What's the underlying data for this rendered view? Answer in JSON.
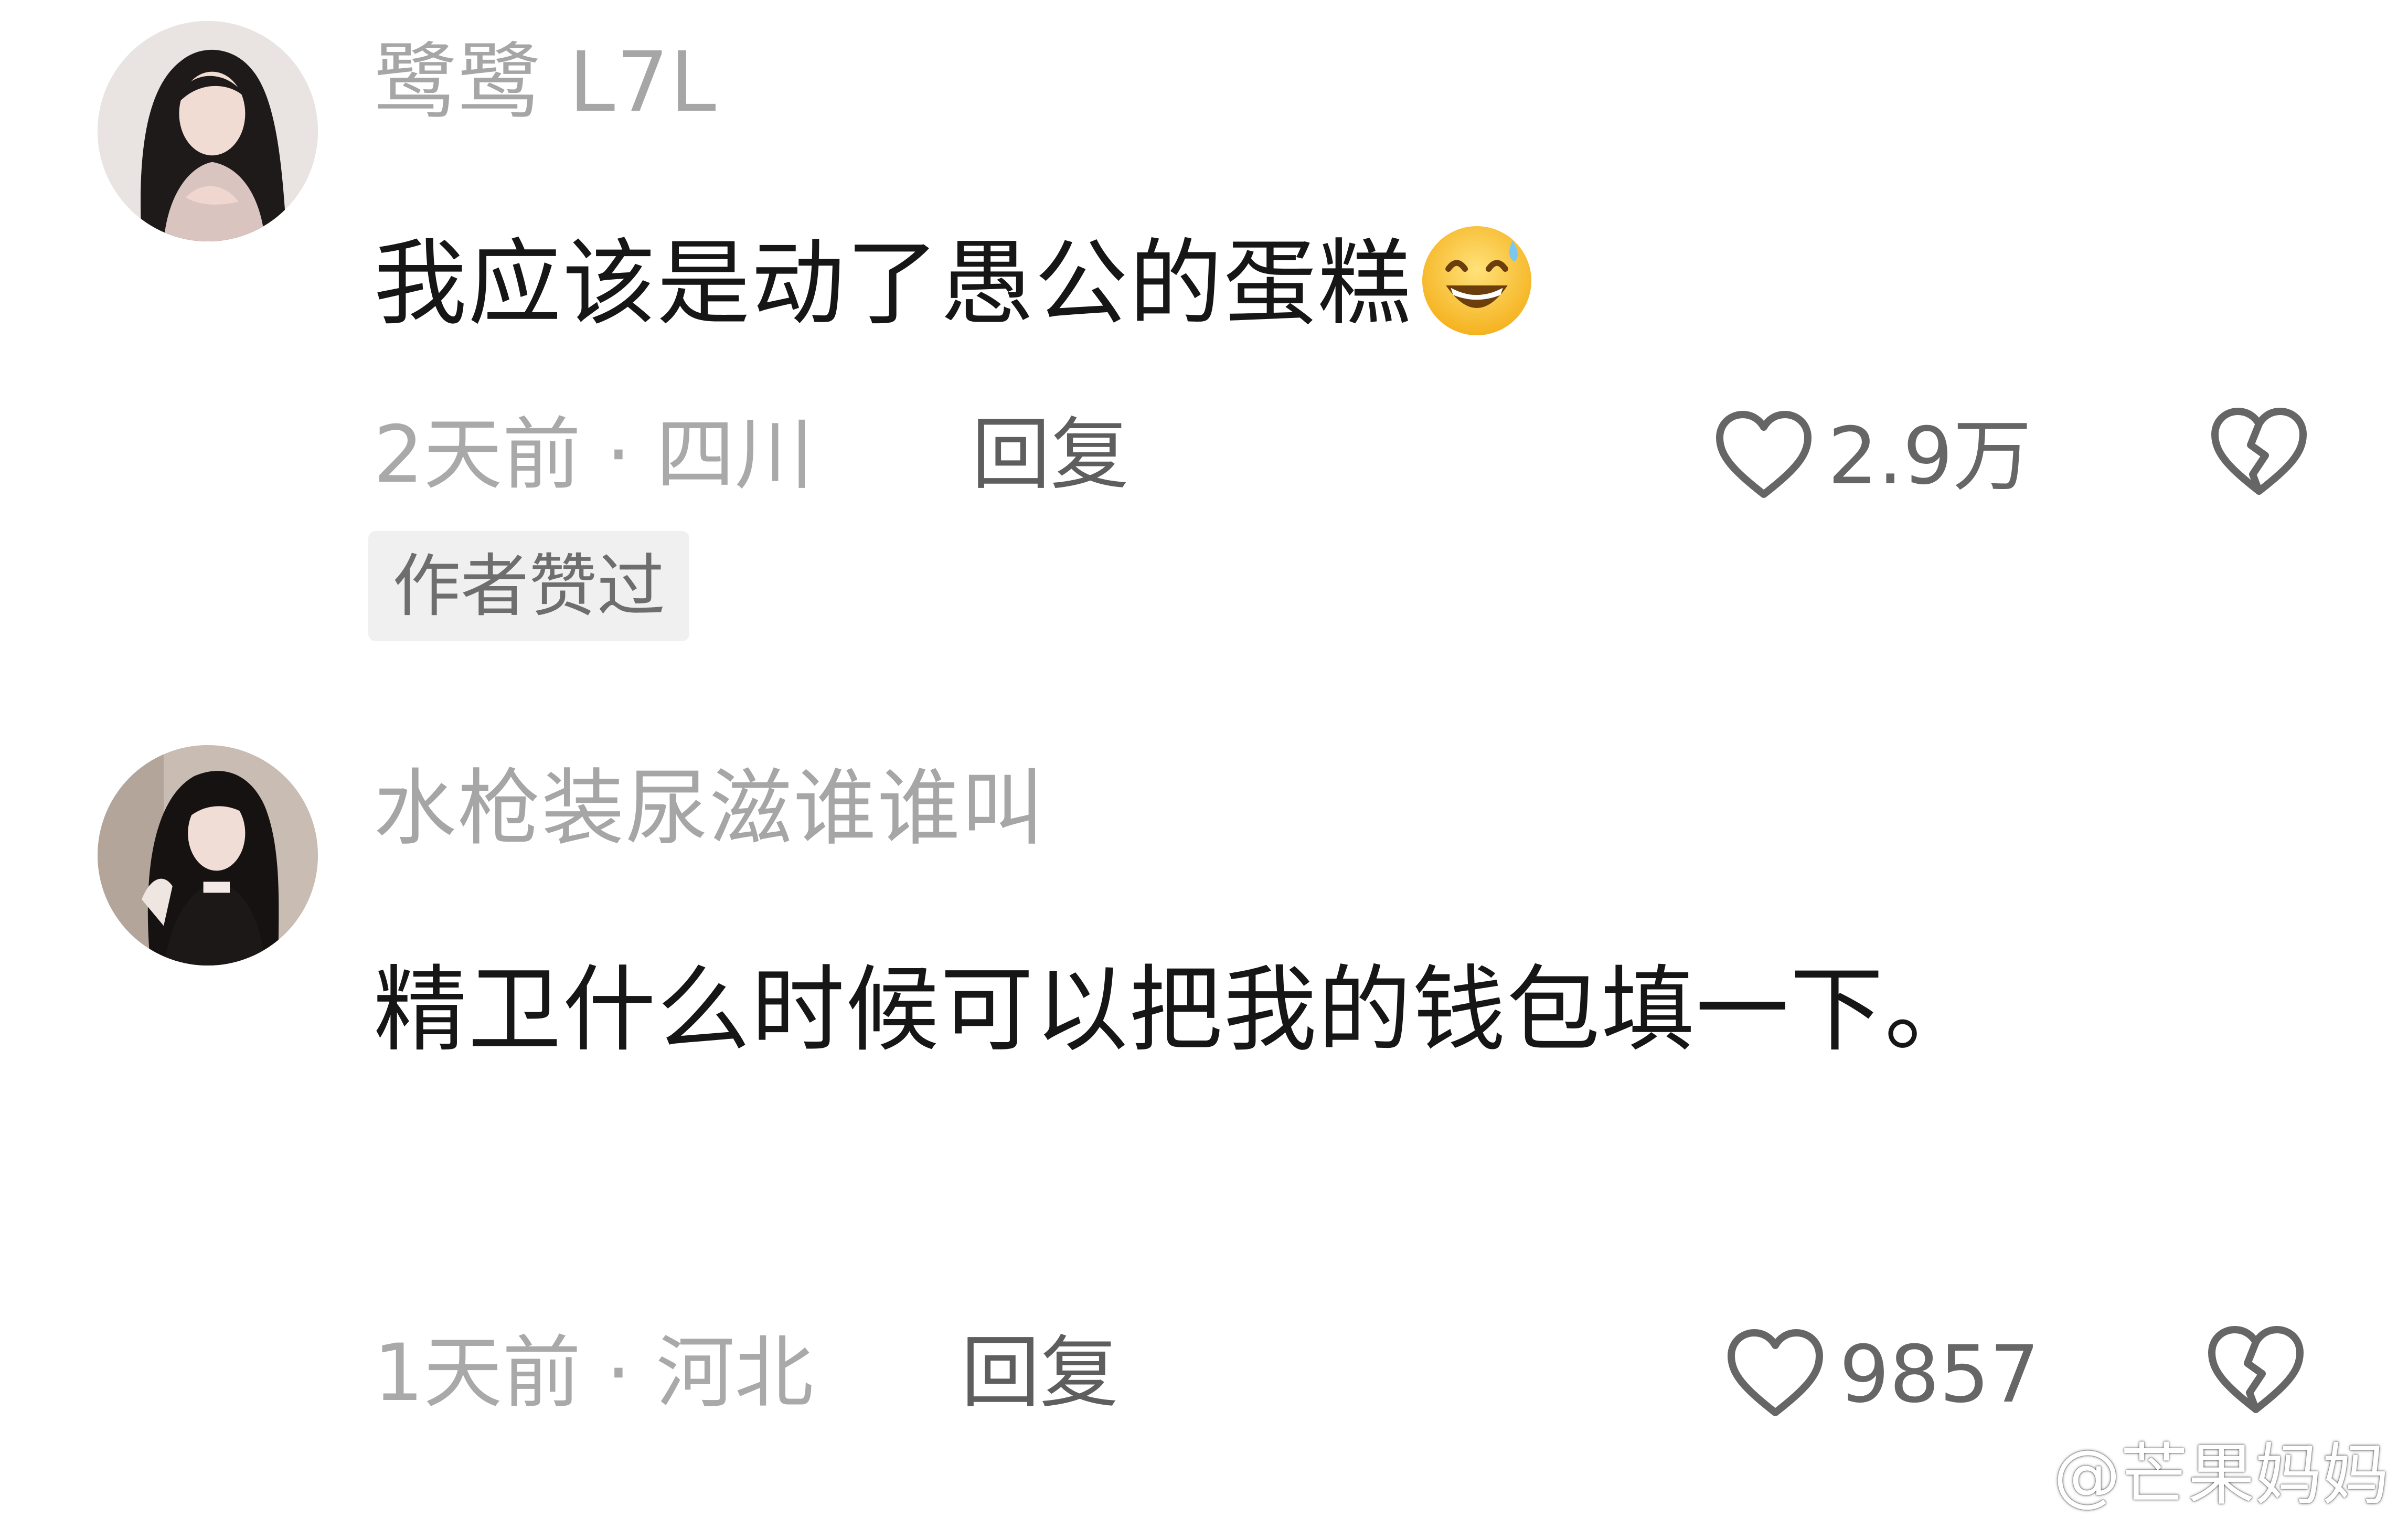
{
  "colors": {
    "username": "#a6a6a6",
    "body": "#161616",
    "meta": "#a9a9a9",
    "reply": "#5e5e5e",
    "icon": "#666666",
    "badge_bg": "#f0f0f0"
  },
  "comments": [
    {
      "username": "鹭鹭 L7L",
      "text": "我应该是动了愚公的蛋糕",
      "emoji": "grinning-sweat-emoji",
      "meta": "2天前 · 四川",
      "reply_label": "回复",
      "like_count": "2.9万",
      "badge": "作者赞过"
    },
    {
      "username": "水枪装尿滋谁谁叫",
      "text": "精卫什么时候可以把我的钱包填一下。",
      "meta": "1天前 · 河北",
      "reply_label": "回复",
      "like_count": "9857"
    }
  ],
  "watermark": {
    "icon": "weibo-icon",
    "text": "@芒果妈妈"
  }
}
